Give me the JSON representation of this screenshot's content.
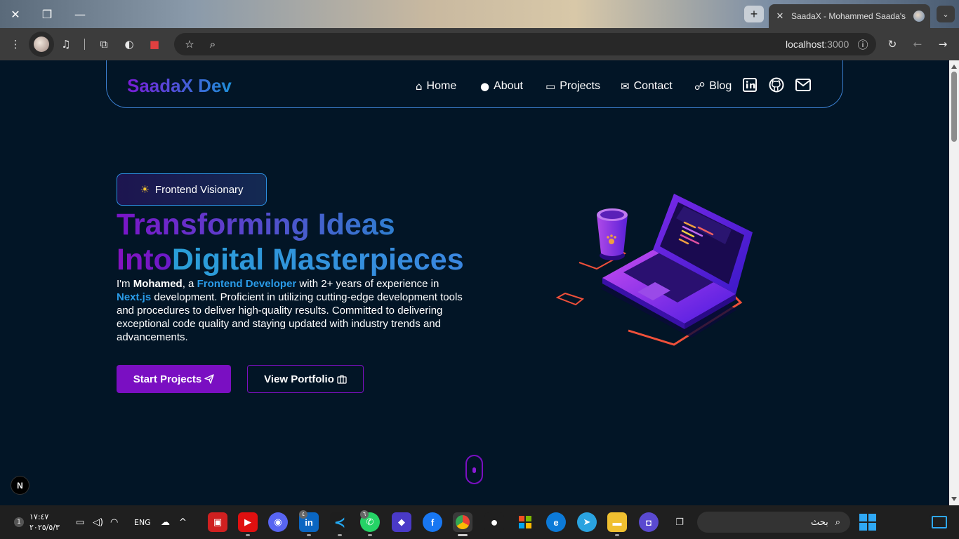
{
  "browser": {
    "tab_title": "SaadaX - Mohammed Saada's P",
    "url_host": "localhost",
    "url_port": ":3000"
  },
  "nav": {
    "logo": "SaadaX Dev",
    "items": [
      {
        "label": "Home",
        "icon": "home-icon"
      },
      {
        "label": "About",
        "icon": "user-icon"
      },
      {
        "label": "Projects",
        "icon": "laptop-icon"
      },
      {
        "label": "Contact",
        "icon": "envelope-icon"
      },
      {
        "label": "Blog",
        "icon": "blog-icon"
      }
    ],
    "social": [
      "linkedin-icon",
      "github-icon",
      "mail-icon"
    ]
  },
  "hero": {
    "badge": "Frontend Visionary",
    "title_line1": "Transforming Ideas",
    "title_line2a": "Into",
    "title_line2b": "Digital Masterpieces",
    "desc": {
      "p1": "I'm ",
      "name": "Mohamed",
      "p2": ", a ",
      "role": "Frontend Developer",
      "p3": " with 2+ years of experience in ",
      "tech": "Next.js",
      "p4": " development. Proficient in utilizing cutting-edge development tools and procedures to deliver high-quality results. Committed to delivering exceptional code quality and staying updated with industry trends and advancements."
    },
    "primary_button": "Start Projects",
    "secondary_button": "View Portfolio"
  },
  "overlay": {
    "next_badge": "N"
  },
  "taskbar": {
    "time": "١٧:٤٧",
    "date": "٢٠٢٥/٥/٣",
    "lang": "ENG",
    "search_placeholder": "بحث",
    "notification_count": "1",
    "badges": {
      "linkedin": "٤",
      "whatsapp": "٦"
    }
  },
  "colors": {
    "page_bg": "#021526",
    "accent_purple": "#7a0fc2",
    "accent_blue": "#2a9be8"
  }
}
